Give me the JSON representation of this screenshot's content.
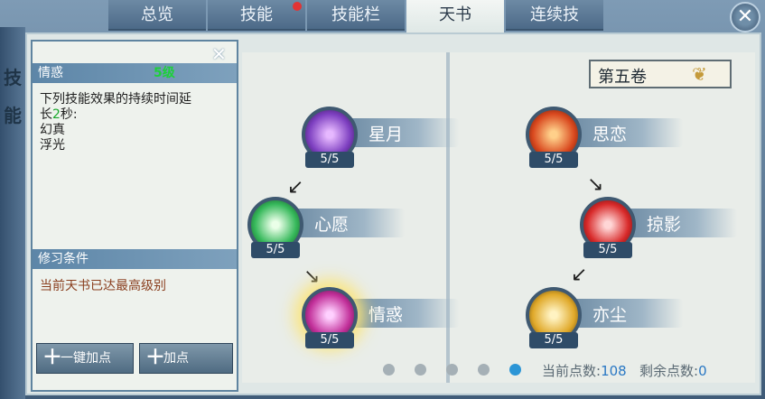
{
  "side_label": [
    "技",
    "能"
  ],
  "tabs": [
    {
      "label": "总览",
      "active": false,
      "dot": false
    },
    {
      "label": "技能",
      "active": false,
      "dot": true
    },
    {
      "label": "技能栏",
      "active": false,
      "dot": false
    },
    {
      "label": "天书",
      "active": true,
      "dot": false
    },
    {
      "label": "连续技",
      "active": false,
      "dot": false
    }
  ],
  "info": {
    "skill_name": "情惑",
    "level": "5级",
    "desc_line1": "下列技能效果的持续时间延",
    "desc_line2_pre": "长",
    "desc_num": "2",
    "desc_line2_post": "秒:",
    "effects": [
      "幻真",
      "浮光"
    ],
    "cond_header": "修习条件",
    "cond_text": "当前天书已达最高级别",
    "btn_auto": "一键加点",
    "btn_add": "加点"
  },
  "volume": "第五卷",
  "nodes": {
    "xingyue": {
      "name": "星月",
      "count": "5/5",
      "color": "#7d3fc0"
    },
    "xinyuan": {
      "name": "心愿",
      "count": "5/5",
      "color": "#35b85a"
    },
    "qinghuo": {
      "name": "情惑",
      "count": "5/5",
      "color": "#c2309a"
    },
    "silian": {
      "name": "思恋",
      "count": "5/5",
      "color": "#d9481e"
    },
    "lueying": {
      "name": "掠影",
      "count": "5/5",
      "color": "#d82a2a"
    },
    "yichen": {
      "name": "亦尘",
      "count": "5/5",
      "color": "#e0a92a"
    }
  },
  "pagination": {
    "total": 5,
    "active_index": 4
  },
  "points": {
    "current_label": "当前点数:",
    "current": "108",
    "remain_label": "剩余点数:",
    "remain": "0"
  }
}
